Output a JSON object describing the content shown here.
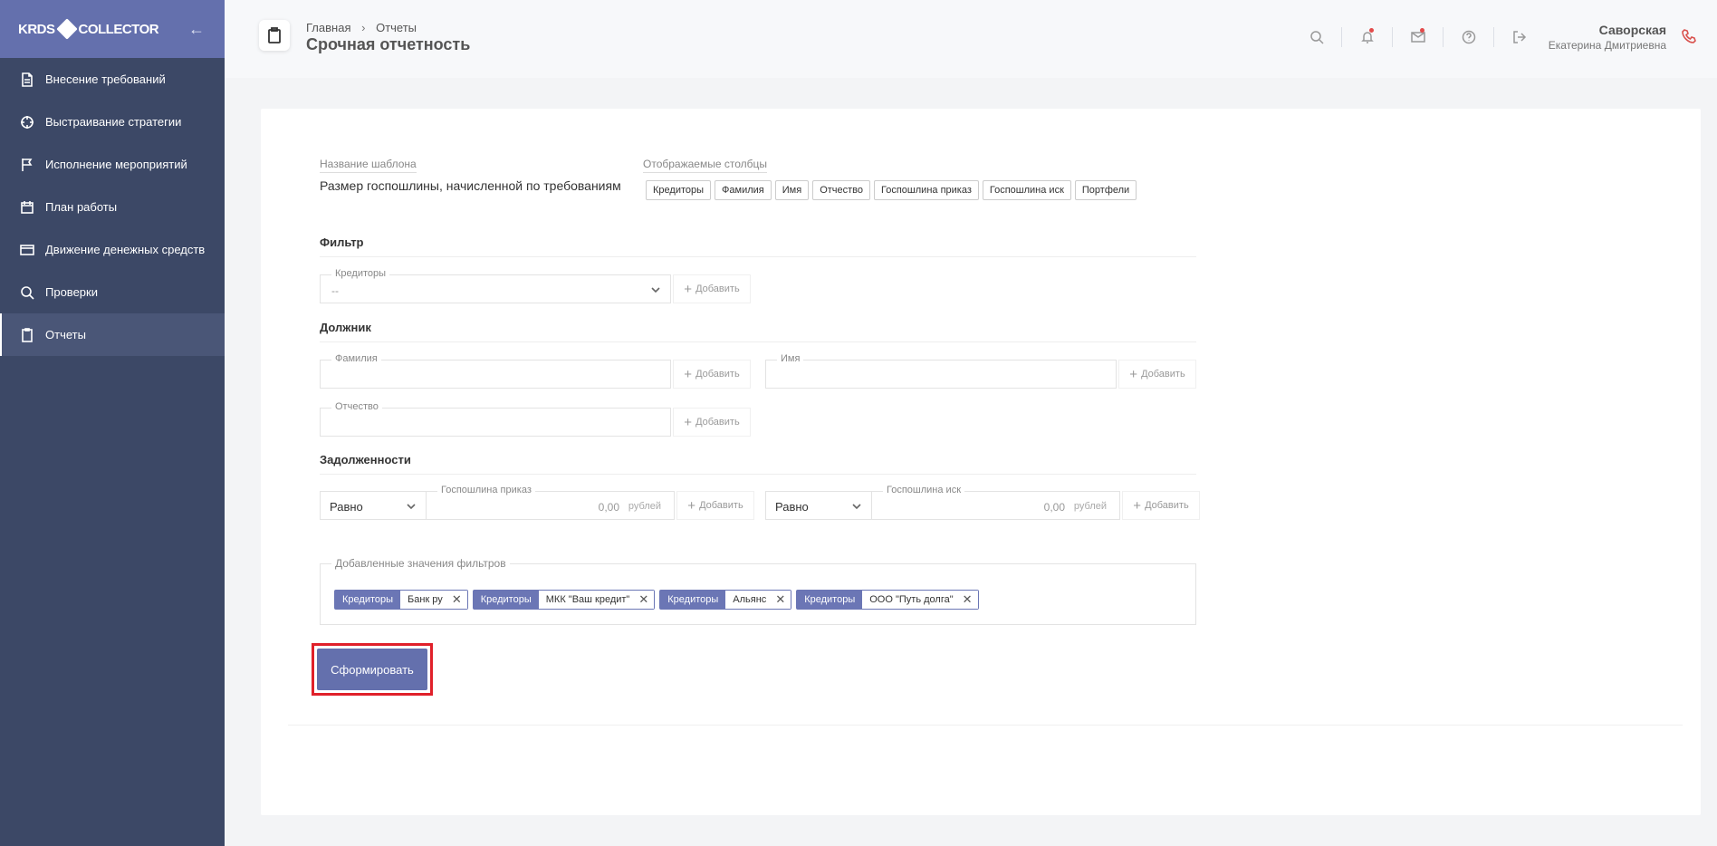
{
  "sidebar": {
    "logo": {
      "left": "KRDS",
      "right": "COLLECTOR"
    },
    "items": [
      {
        "label": "Внесение требований",
        "icon": "document-icon"
      },
      {
        "label": "Выстраивание стратегии",
        "icon": "target-icon"
      },
      {
        "label": "Исполнение мероприятий",
        "icon": "flag-icon"
      },
      {
        "label": "План работы",
        "icon": "calendar-icon"
      },
      {
        "label": "Движение денежных средств",
        "icon": "card-icon"
      },
      {
        "label": "Проверки",
        "icon": "search-icon"
      },
      {
        "label": "Отчеты",
        "icon": "clipboard-icon",
        "active": true
      }
    ]
  },
  "header": {
    "breadcrumb": [
      "Главная",
      "Отчеты"
    ],
    "title": "Срочная отчетность",
    "user": {
      "last_name": "Саворская",
      "first_name": "Екатерина Дмитриевна"
    }
  },
  "form": {
    "template_label": "Название шаблона",
    "template_value": "Размер госпошлины, начисленной по требованиям",
    "columns_label": "Отображаемые столбцы",
    "columns": [
      "Кредиторы",
      "Фамилия",
      "Имя",
      "Отчество",
      "Госпошлина приказ",
      "Госпошлина иск",
      "Портфели"
    ],
    "filter_title": "Фильтр",
    "creditors_label": "Кредиторы",
    "creditors_value": "--",
    "add_label": "Добавить",
    "debtor_title": "Должник",
    "surname_label": "Фамилия",
    "name_label": "Имя",
    "patronymic_label": "Отчество",
    "debts_title": "Задолженности",
    "compare_value": "Равно",
    "fee_order_label": "Госпошлина приказ",
    "fee_claim_label": "Госпошлина иск",
    "amount_value": "0,00",
    "currency": "рублей",
    "added_label": "Добавленные значения фильтров",
    "added_tags": [
      {
        "key": "Кредиторы",
        "value": "Банк ру"
      },
      {
        "key": "Кредиторы",
        "value": "МКК \"Ваш кредит\""
      },
      {
        "key": "Кредиторы",
        "value": "Альянс"
      },
      {
        "key": "Кредиторы",
        "value": "ООО \"Путь долга\""
      }
    ],
    "submit_label": "Сформировать"
  }
}
